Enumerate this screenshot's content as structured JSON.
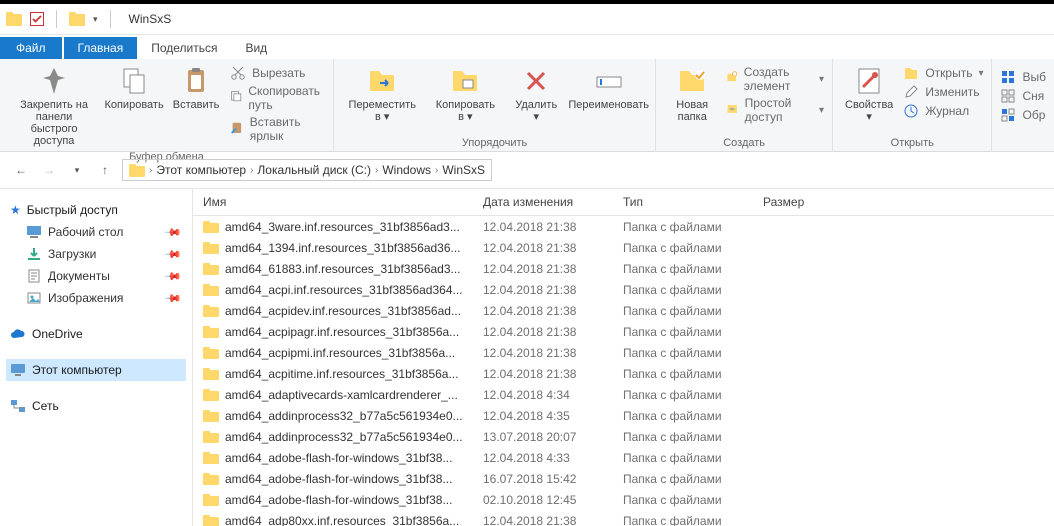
{
  "window": {
    "title": "WinSxS"
  },
  "quick_access_checked": true,
  "menu": {
    "file": "Файл",
    "tabs": [
      "Главная",
      "Поделиться",
      "Вид"
    ],
    "active_tab": 0
  },
  "ribbon": {
    "groups": {
      "clipboard": {
        "label": "Буфер обмена",
        "pin": "Закрепить на панели\nбыстрого доступа",
        "copy": "Копировать",
        "paste": "Вставить",
        "cut": "Вырезать",
        "copy_path": "Скопировать путь",
        "paste_shortcut": "Вставить ярлык"
      },
      "organize": {
        "label": "Упорядочить",
        "move_to": "Переместить в",
        "copy_to": "Копировать в",
        "delete": "Удалить",
        "rename": "Переименовать"
      },
      "new": {
        "label": "Создать",
        "new_folder": "Новая\nпапка",
        "new_item": "Создать элемент",
        "easy_access": "Простой доступ"
      },
      "open": {
        "label": "Открыть",
        "properties": "Свойства",
        "open": "Открыть",
        "edit": "Изменить",
        "history": "Журнал"
      },
      "select": {
        "select_all": "Выб",
        "select_none": "Сня",
        "invert": "Обр"
      }
    }
  },
  "breadcrumb": {
    "segments": [
      "Этот компьютер",
      "Локальный диск (C:)",
      "Windows",
      "WinSxS"
    ]
  },
  "columns": {
    "name": "Имя",
    "date": "Дата изменения",
    "type": "Тип",
    "size": "Размер"
  },
  "sidebar": {
    "quick": {
      "title": "Быстрый доступ",
      "items": [
        {
          "label": "Рабочий стол",
          "icon": "desktop"
        },
        {
          "label": "Загрузки",
          "icon": "downloads"
        },
        {
          "label": "Документы",
          "icon": "documents"
        },
        {
          "label": "Изображения",
          "icon": "pictures"
        }
      ]
    },
    "onedrive": "OneDrive",
    "this_pc": "Этот компьютер",
    "network": "Сеть"
  },
  "files": [
    {
      "name": "amd64_3ware.inf.resources_31bf3856ad3...",
      "date": "12.04.2018 21:38",
      "type": "Папка с файлами"
    },
    {
      "name": "amd64_1394.inf.resources_31bf3856ad36...",
      "date": "12.04.2018 21:38",
      "type": "Папка с файлами"
    },
    {
      "name": "amd64_61883.inf.resources_31bf3856ad3...",
      "date": "12.04.2018 21:38",
      "type": "Папка с файлами"
    },
    {
      "name": "amd64_acpi.inf.resources_31bf3856ad364...",
      "date": "12.04.2018 21:38",
      "type": "Папка с файлами"
    },
    {
      "name": "amd64_acpidev.inf.resources_31bf3856ad...",
      "date": "12.04.2018 21:38",
      "type": "Папка с файлами"
    },
    {
      "name": "amd64_acpipagr.inf.resources_31bf3856a...",
      "date": "12.04.2018 21:38",
      "type": "Папка с файлами"
    },
    {
      "name": "amd64_acpipmi.inf.resources_31bf3856a...",
      "date": "12.04.2018 21:38",
      "type": "Папка с файлами"
    },
    {
      "name": "amd64_acpitime.inf.resources_31bf3856a...",
      "date": "12.04.2018 21:38",
      "type": "Папка с файлами"
    },
    {
      "name": "amd64_adaptivecards-xamlcardrenderer_...",
      "date": "12.04.2018 4:34",
      "type": "Папка с файлами"
    },
    {
      "name": "amd64_addinprocess32_b77a5c561934e0...",
      "date": "12.04.2018 4:35",
      "type": "Папка с файлами"
    },
    {
      "name": "amd64_addinprocess32_b77a5c561934e0...",
      "date": "13.07.2018 20:07",
      "type": "Папка с файлами"
    },
    {
      "name": "amd64_adobe-flash-for-windows_31bf38...",
      "date": "12.04.2018 4:33",
      "type": "Папка с файлами"
    },
    {
      "name": "amd64_adobe-flash-for-windows_31bf38...",
      "date": "16.07.2018 15:42",
      "type": "Папка с файлами"
    },
    {
      "name": "amd64_adobe-flash-for-windows_31bf38...",
      "date": "02.10.2018 12:45",
      "type": "Папка с файлами"
    },
    {
      "name": "amd64_adp80xx.inf.resources_31bf3856a...",
      "date": "12.04.2018 21:38",
      "type": "Папка с файлами"
    }
  ]
}
